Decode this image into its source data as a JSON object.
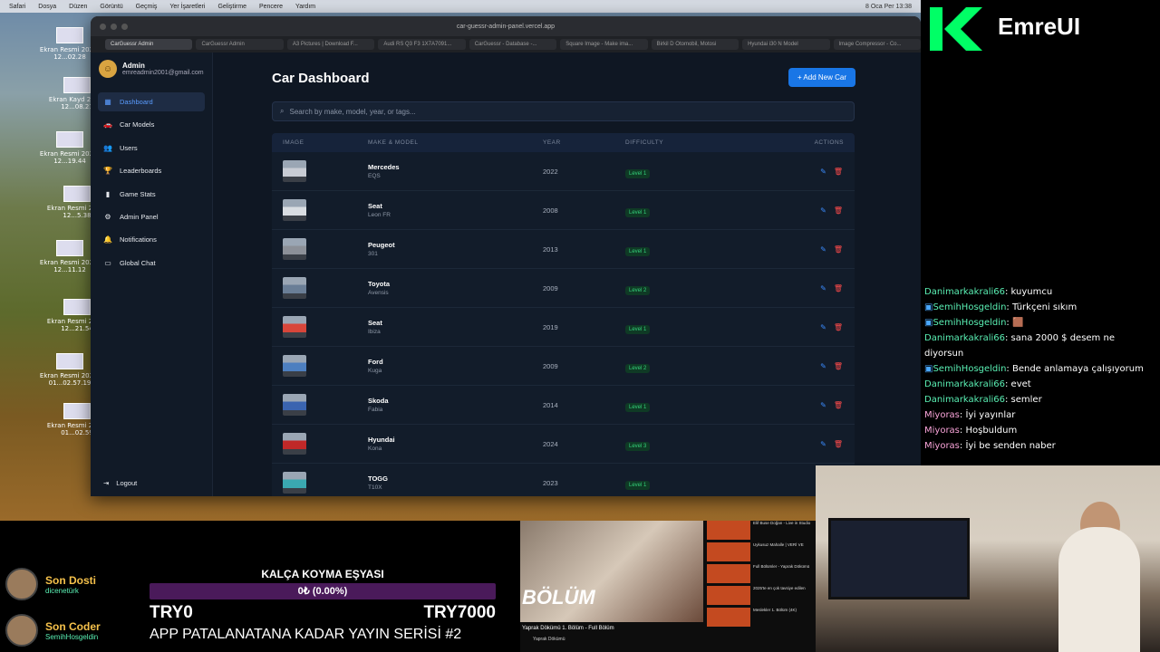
{
  "menubar": {
    "items": [
      "Safari",
      "Dosya",
      "Düzen",
      "Görüntü",
      "Geçmiş",
      "Yer İşaretleri",
      "Geliştirme",
      "Pencere",
      "Yardım"
    ],
    "clock": "8 Oca Per 13:38"
  },
  "desktop": {
    "icons": [
      {
        "label": "Ekran Resmi 2025-12...02.28"
      },
      {
        "label": "Ekran Kayd 2025-12...08.21"
      },
      {
        "label": "Ekran Resmi 2025-12...19.44"
      },
      {
        "label": "Ekran Resmi 2025-12...5.38"
      },
      {
        "label": "Ekran Resmi 2025-12...11.12"
      },
      {
        "label": "Ekran Resmi 2025-12...21.54"
      },
      {
        "label": "Ekran Resmi 2026-01...02.57.19"
      },
      {
        "label": "Ekran Resmi 2026-01...02.59"
      }
    ]
  },
  "browser": {
    "url": "car-guessr-admin-panel.vercel.app",
    "tabs": [
      "CarGuessr Admin",
      "CarGuessr Admin",
      "A3 Pictures | Download F...",
      "Audi RS Q3 F3 1X7A7091...",
      "CarGuessr - Database -...",
      "Square Image - Make ima...",
      "Birkil D Otomobil, Motosi",
      "Hyundai i30 N Model",
      "Image Compressor - Co..."
    ],
    "active_tab": 0
  },
  "sidebar": {
    "profile": {
      "name": "Admin",
      "email": "emreadmin2001@gmail.com"
    },
    "items": [
      {
        "label": "Dashboard",
        "icon": "grid-icon",
        "glyph": "▦",
        "active": true
      },
      {
        "label": "Car Models",
        "icon": "car-icon",
        "glyph": "🚗",
        "active": false
      },
      {
        "label": "Users",
        "icon": "users-icon",
        "glyph": "👥",
        "active": false
      },
      {
        "label": "Leaderboards",
        "icon": "trophy-icon",
        "glyph": "🏆",
        "active": false
      },
      {
        "label": "Game Stats",
        "icon": "bar-chart-icon",
        "glyph": "▮",
        "active": false
      },
      {
        "label": "Admin Panel",
        "icon": "gear-icon",
        "glyph": "⚙",
        "active": false
      },
      {
        "label": "Notifications",
        "icon": "bell-icon",
        "glyph": "🔔",
        "active": false
      },
      {
        "label": "Global Chat",
        "icon": "chat-icon",
        "glyph": "▭",
        "active": false
      }
    ],
    "logout_label": "Logout"
  },
  "main": {
    "title": "Car Dashboard",
    "add_button": "+  Add New Car",
    "search_placeholder": "Search by make, model, year, or tags...",
    "columns": [
      "IMAGE",
      "MAKE & MODEL",
      "YEAR",
      "DIFFICULTY",
      "ACTIONS"
    ],
    "rows": [
      {
        "make": "Mercedes",
        "model": "EQS",
        "year": "2022",
        "difficulty": "Level 1",
        "color": "#c8ccd4"
      },
      {
        "make": "Seat",
        "model": "Leon FR",
        "year": "2008",
        "difficulty": "Level 1",
        "color": "#d9dde2"
      },
      {
        "make": "Peugeot",
        "model": "301",
        "year": "2013",
        "difficulty": "Level 1",
        "color": "#8c9098"
      },
      {
        "make": "Toyota",
        "model": "Avensis",
        "year": "2009",
        "difficulty": "Level 2",
        "color": "#6a7e96"
      },
      {
        "make": "Seat",
        "model": "Ibiza",
        "year": "2019",
        "difficulty": "Level 1",
        "color": "#d8463a"
      },
      {
        "make": "Ford",
        "model": "Kuga",
        "year": "2009",
        "difficulty": "Level 2",
        "color": "#4d7fc0"
      },
      {
        "make": "Skoda",
        "model": "Fabia",
        "year": "2014",
        "difficulty": "Level 1",
        "color": "#3a64b0"
      },
      {
        "make": "Hyundai",
        "model": "Kona",
        "year": "2024",
        "difficulty": "Level 3",
        "color": "#c02828"
      },
      {
        "make": "TOGG",
        "model": "T10X",
        "year": "2023",
        "difficulty": "Level 1",
        "color": "#3aa8b0"
      }
    ]
  },
  "brand": {
    "name": "EmreUI",
    "accent": "#00ff66"
  },
  "chat": [
    {
      "user": "Danimarkakrali66",
      "text": "kuyumcu",
      "cls": "u1",
      "icon": false
    },
    {
      "user": "SemihHosgeldin",
      "text": "Türkçeni sıkım",
      "cls": "u1",
      "icon": true
    },
    {
      "user": "SemihHosgeldin",
      "text": "🟫",
      "cls": "u1",
      "icon": true
    },
    {
      "user": "Danimarkakrali66",
      "text": "sana 2000 $ desem ne diyorsun",
      "cls": "u1",
      "icon": false
    },
    {
      "user": "SemihHosgeldin",
      "text": "Bende anlamaya çalışıyorum",
      "cls": "u1",
      "icon": true
    },
    {
      "user": "Danimarkakrali66",
      "text": "evet",
      "cls": "u1",
      "icon": false
    },
    {
      "user": "Danimarkakrali66",
      "text": "semler",
      "cls": "u1",
      "icon": false
    },
    {
      "user": "Miyoras",
      "text": "İyi yayınlar",
      "cls": "u3",
      "icon": false
    },
    {
      "user": "Miyoras",
      "text": "Hoşbuldum",
      "cls": "u3",
      "icon": false
    },
    {
      "user": "Miyoras",
      "text": "İyi be senden naber",
      "cls": "u3",
      "icon": false
    }
  ],
  "overlay": {
    "members": [
      {
        "title": "Son Dosti",
        "name": "dicenetürk"
      },
      {
        "title": "Son Coder",
        "name": "SemihHosgeldin"
      }
    ],
    "goal": {
      "title": "KALÇA KOYMA EŞYASI",
      "progress_text": "0₺ (0.00%)",
      "progress": 0,
      "min": "TRY0",
      "max": "TRY7000"
    },
    "series": "APP PATALANATANA KADAR YAYIN SERİSİ #2"
  },
  "youtube": {
    "overlay_word": "BÖLÜM",
    "title": "Yaprak Dökümü 1. Bölüm - Full Bölüm",
    "channel": "Yaprak Dökümü",
    "sidebar": [
      "Elif Buse Doğan - Live in Studio",
      "Uykusuz Mahalle | VERİ VE",
      "Full Bölümler - Yaprak Dökümü",
      "2025'te en çok tavsiye edilen",
      "Meslekler 1. Bölüm (4K)"
    ]
  }
}
